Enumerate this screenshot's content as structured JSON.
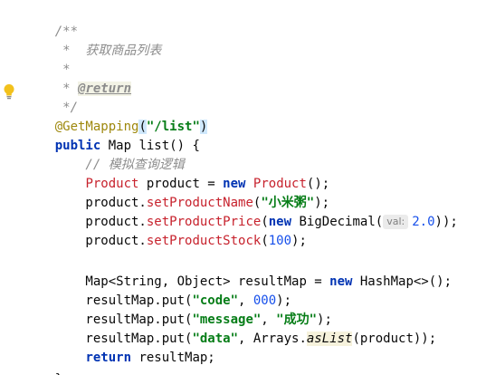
{
  "editor": {
    "lines": {
      "l1": "/**",
      "l2": " *  获取商品列表",
      "l3": " *",
      "l4_prefix": " * ",
      "l4_tag": "@return",
      "l5": " */",
      "l6": {
        "annotation": "@GetMapping",
        "open_paren": "(",
        "string": "\"/list\"",
        "close_paren": ")"
      },
      "l7": {
        "kw_public": "public",
        "rest": " Map list() {"
      },
      "l8": "    // 模拟查询逻辑",
      "l9": {
        "indent": "    ",
        "type": "Product",
        "mid": " product = ",
        "kw_new": "new",
        "sp": " ",
        "ctor": "Product",
        "end": "();"
      },
      "l10": {
        "indent": "    product.",
        "method": "setProductName",
        "open": "(",
        "string": "\"小米粥\"",
        "end": ");"
      },
      "l11": {
        "indent": "    product.",
        "method": "setProductPrice",
        "open": "(",
        "kw_new": "new",
        "mid": " BigDecimal(",
        "hint": "val:",
        "number": "2.0",
        "end": "));"
      },
      "l12": {
        "indent": "    product.",
        "method": "setProductStock",
        "open": "(",
        "number": "100",
        "end": ");"
      },
      "l13": "",
      "l14": {
        "start": "    Map<String, Object> resultMap = ",
        "kw_new": "new",
        "end": " HashMap<>();"
      },
      "l15": {
        "start": "    resultMap.put(",
        "string": "\"code\"",
        "comma": ", ",
        "number": "000",
        "end": ");"
      },
      "l16": {
        "start": "    resultMap.put(",
        "string": "\"message\"",
        "comma": ", ",
        "string2": "\"成功\"",
        "end": ");"
      },
      "l17": {
        "start": "    resultMap.put(",
        "string": "\"data\"",
        "mid": ", Arrays.",
        "call": "asList",
        "end": "(product));"
      },
      "l18": {
        "indent": "    ",
        "kw_return": "return",
        "end": " resultMap;"
      },
      "l19": "}"
    },
    "gutter_icon": "lightbulb-icon",
    "colors": {
      "keyword": "#0033b3",
      "string": "#067d17",
      "number": "#1750eb",
      "comment": "#8c8c8c",
      "annotation": "#9e880d",
      "warning_red": "#c7222d"
    }
  }
}
